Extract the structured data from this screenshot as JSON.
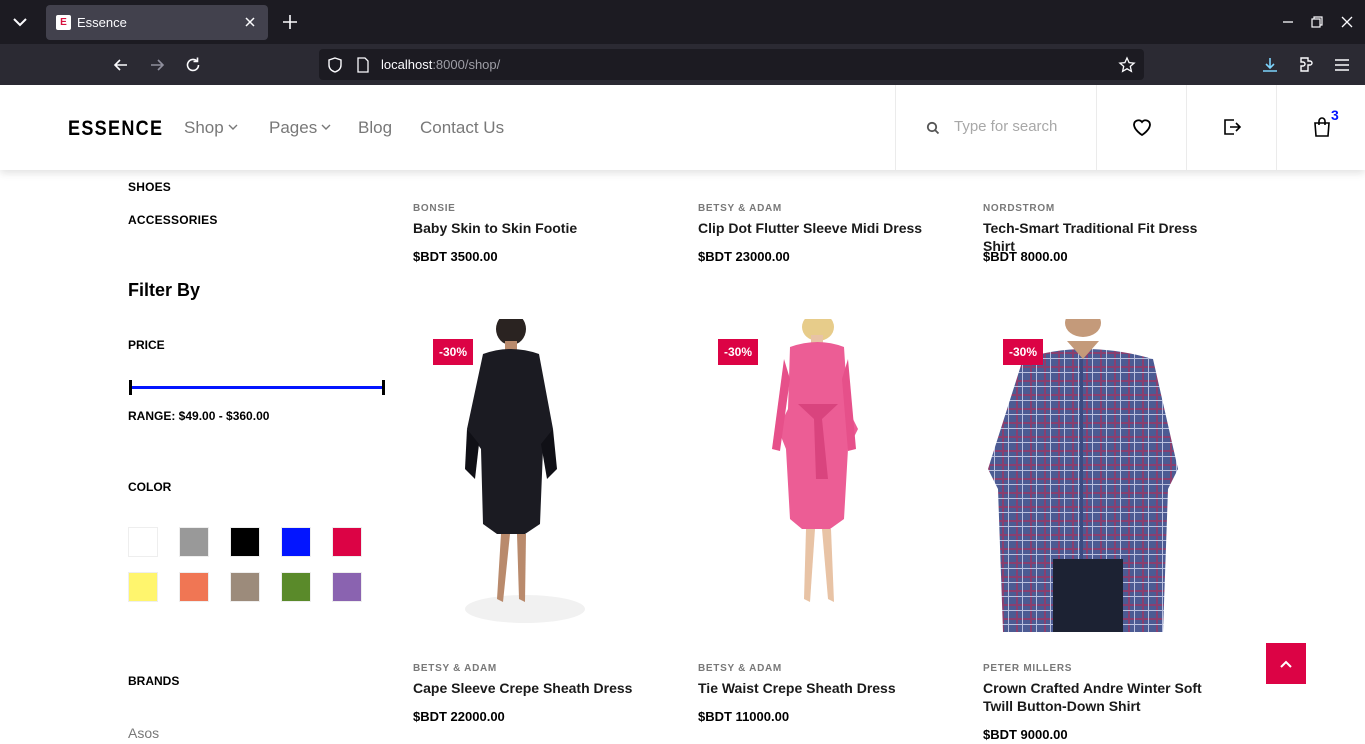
{
  "browser": {
    "tab_title": "Essence",
    "tab_favicon_letter": "E",
    "url_host": "localhost",
    "url_path": ":8000/shop/"
  },
  "header": {
    "logo": "ESSENCE",
    "menu": [
      {
        "label": "Shop",
        "has_dropdown": true
      },
      {
        "label": "Pages",
        "has_dropdown": true
      },
      {
        "label": "Blog",
        "has_dropdown": false
      },
      {
        "label": "Contact Us",
        "has_dropdown": false
      }
    ],
    "search_placeholder": "Type for search",
    "cart_count": "3"
  },
  "sidebar": {
    "categories": [
      "SHOES",
      "ACCESSORIES"
    ],
    "filter_title": "Filter By",
    "price_title": "PRICE",
    "range_text": "RANGE: $49.00 - $360.00",
    "color_title": "COLOR",
    "colors": [
      "#ffffff",
      "#999999",
      "#000000",
      "#0315ff",
      "#dc0345",
      "#fff56d",
      "#f07654",
      "#9c8b7b",
      "#5a8a2a",
      "#8a63b0"
    ],
    "brands_title": "BRANDS",
    "brands": [
      "Asos"
    ]
  },
  "products_top": [
    {
      "brand": "BONSIE",
      "name": "Baby Skin to Skin Footie",
      "price": "$BDT 3500.00"
    },
    {
      "brand": "BETSY & ADAM",
      "name": "Clip Dot Flutter Sleeve Midi Dress",
      "price": "$BDT 23000.00"
    },
    {
      "brand": "NORDSTROM",
      "name": "Tech-Smart Traditional Fit Dress Shirt",
      "price": "$BDT 8000.00"
    }
  ],
  "products": [
    {
      "badge": "-30%",
      "brand": "BETSY & ADAM",
      "name": "Cape Sleeve Crepe Sheath Dress",
      "price": "$BDT 22000.00"
    },
    {
      "badge": "-30%",
      "brand": "BETSY & ADAM",
      "name": "Tie Waist Crepe Sheath Dress",
      "price": "$BDT 11000.00"
    },
    {
      "badge": "-30%",
      "brand": "PETER MILLERS",
      "name": "Crown Crafted Andre Winter Soft Twill Button-Down Shirt",
      "price": "$BDT 9000.00"
    }
  ]
}
